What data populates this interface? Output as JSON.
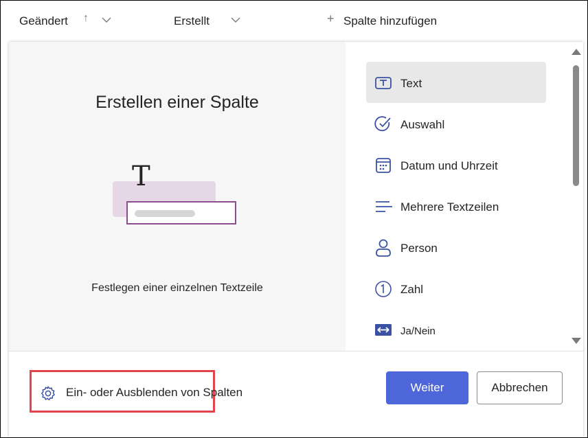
{
  "header": {
    "changed_label": "Geändert",
    "created_label": "Erstellt",
    "add_column_label": "Spalte hinzufügen",
    "add_icon": "+"
  },
  "dialog": {
    "title": "Erstellen einer Spalte",
    "illustration_glyph": "T",
    "description": "Festlegen einer einzelnen Textzeile",
    "types": [
      {
        "label": "Text",
        "icon": "text-box-icon",
        "selected": true
      },
      {
        "label": "Auswahl",
        "icon": "check-circle-icon",
        "selected": false
      },
      {
        "label": "Datum und Uhrzeit",
        "icon": "calendar-icon",
        "selected": false
      },
      {
        "label": "Mehrere Textzeilen",
        "icon": "lines-icon",
        "selected": false
      },
      {
        "label": "Person",
        "icon": "person-icon",
        "selected": false
      },
      {
        "label": "Zahl",
        "icon": "number-circle-icon",
        "selected": false
      },
      {
        "label": "Ja/Nein",
        "icon": "toggle-icon",
        "selected": false
      }
    ],
    "show_hide_label": "Ein- oder Ausblenden von Spalten",
    "next_button": "Weiter",
    "cancel_button": "Abbrechen"
  },
  "colors": {
    "accent": "#4d66d9",
    "icon": "#3b52a4",
    "highlight_box": "#e3434d",
    "illustration_border": "#8f4b8f"
  }
}
